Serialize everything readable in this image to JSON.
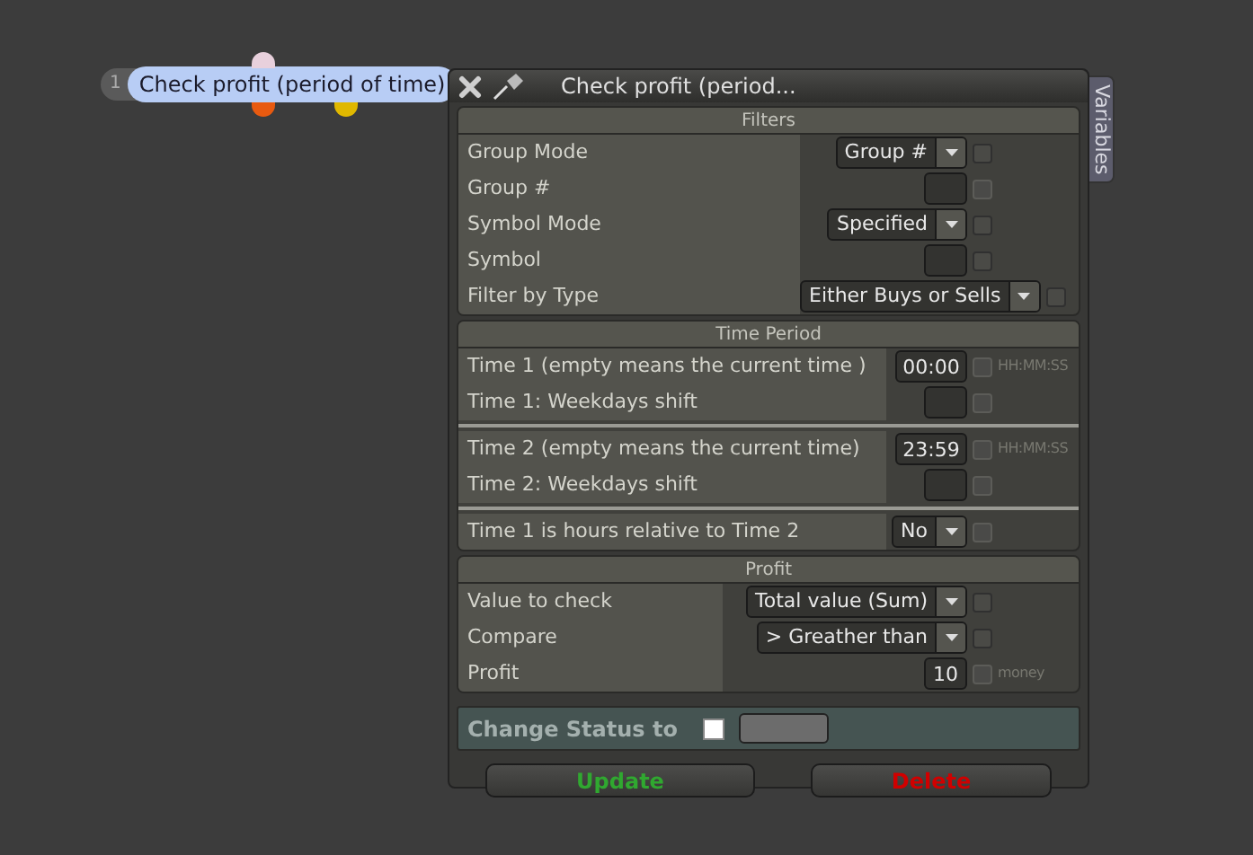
{
  "node": {
    "number": "1",
    "label": "Check profit (period of time)"
  },
  "window": {
    "title": "Check profit (period...",
    "side_tab": "Variables"
  },
  "sections": [
    {
      "title": "Filters",
      "groups": [
        [
          {
            "label": "Group Mode",
            "kind": "select",
            "value": "Group #",
            "checkbox_disabled": true,
            "checked": false
          },
          {
            "label": "Group #",
            "kind": "input",
            "checkbox_disabled": false,
            "checked": false
          },
          {
            "label": "Symbol Mode",
            "kind": "select",
            "value": "Specified",
            "checkbox_disabled": true,
            "checked": false
          },
          {
            "label": "Symbol",
            "kind": "input",
            "checkbox_disabled": true,
            "checked": false
          },
          {
            "label": "Filter by Type",
            "kind": "select",
            "value": "Either Buys or Sells",
            "checkbox_disabled": true,
            "checked": false
          }
        ]
      ]
    },
    {
      "title": "Time Period",
      "groups": [
        [
          {
            "label": "Time 1 (empty means the current time )",
            "kind": "input",
            "value": "00:00",
            "checkbox_disabled": false,
            "checked": false,
            "hint": "HH:MM:SS"
          },
          {
            "label": "Time 1: Weekdays shift",
            "kind": "input",
            "checkbox_disabled": false,
            "checked": false
          }
        ],
        [
          {
            "label": "Time 2 (empty means the current time)",
            "kind": "input",
            "value": "23:59",
            "checkbox_disabled": false,
            "checked": false,
            "hint": "HH:MM:SS"
          },
          {
            "label": "Time 2: Weekdays shift",
            "kind": "input",
            "checkbox_disabled": false,
            "checked": false
          }
        ],
        [
          {
            "label": "Time 1 is hours relative to Time 2",
            "kind": "select",
            "value": "No",
            "checkbox_disabled": false,
            "checked": false
          }
        ]
      ]
    },
    {
      "title": "Profit",
      "groups": [
        [
          {
            "label": "Value to check",
            "kind": "select",
            "value": "Total value (Sum)",
            "checkbox_disabled": true,
            "checked": false
          },
          {
            "label": "Compare",
            "kind": "select",
            "value": "> Greather than",
            "checkbox_disabled": true,
            "checked": false
          },
          {
            "label": "Profit",
            "kind": "input",
            "value": "10",
            "checkbox_disabled": false,
            "checked": false,
            "hint": "money"
          }
        ]
      ]
    }
  ],
  "status": {
    "label": "Change Status to",
    "checked": false
  },
  "buttons": [
    {
      "label": "Update",
      "kind": "update"
    },
    {
      "label": "Delete",
      "kind": "delete"
    }
  ]
}
